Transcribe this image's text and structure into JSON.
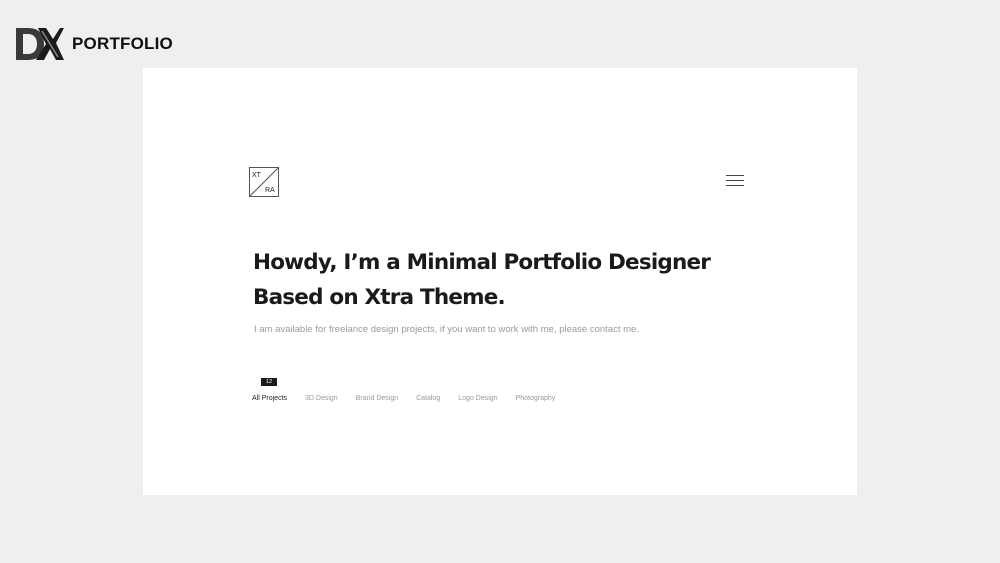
{
  "brand": {
    "logo_icon": "dx-logo-icon",
    "name": "PORTFOLIO"
  },
  "site": {
    "logo_top": "XT",
    "logo_bottom": "RA",
    "menu_icon": "hamburger-menu-icon"
  },
  "hero": {
    "title_line1": "Howdy, I’m a Minimal Portfolio Designer",
    "title_line2": "Based on Xtra Theme.",
    "subtitle": "I am available for freelance design projects, if you want to work with me, please contact me."
  },
  "filters": {
    "count": "12",
    "items": [
      {
        "label": "All Projects",
        "active": true
      },
      {
        "label": "3D Design",
        "active": false
      },
      {
        "label": "Brand Design",
        "active": false
      },
      {
        "label": "Catalog",
        "active": false
      },
      {
        "label": "Logo Design",
        "active": false
      },
      {
        "label": "Photography",
        "active": false
      }
    ]
  },
  "colors": {
    "background": "#efefef",
    "panel": "#ffffff",
    "text_dark": "#1a1a1a",
    "text_muted": "#9a9a9a"
  }
}
